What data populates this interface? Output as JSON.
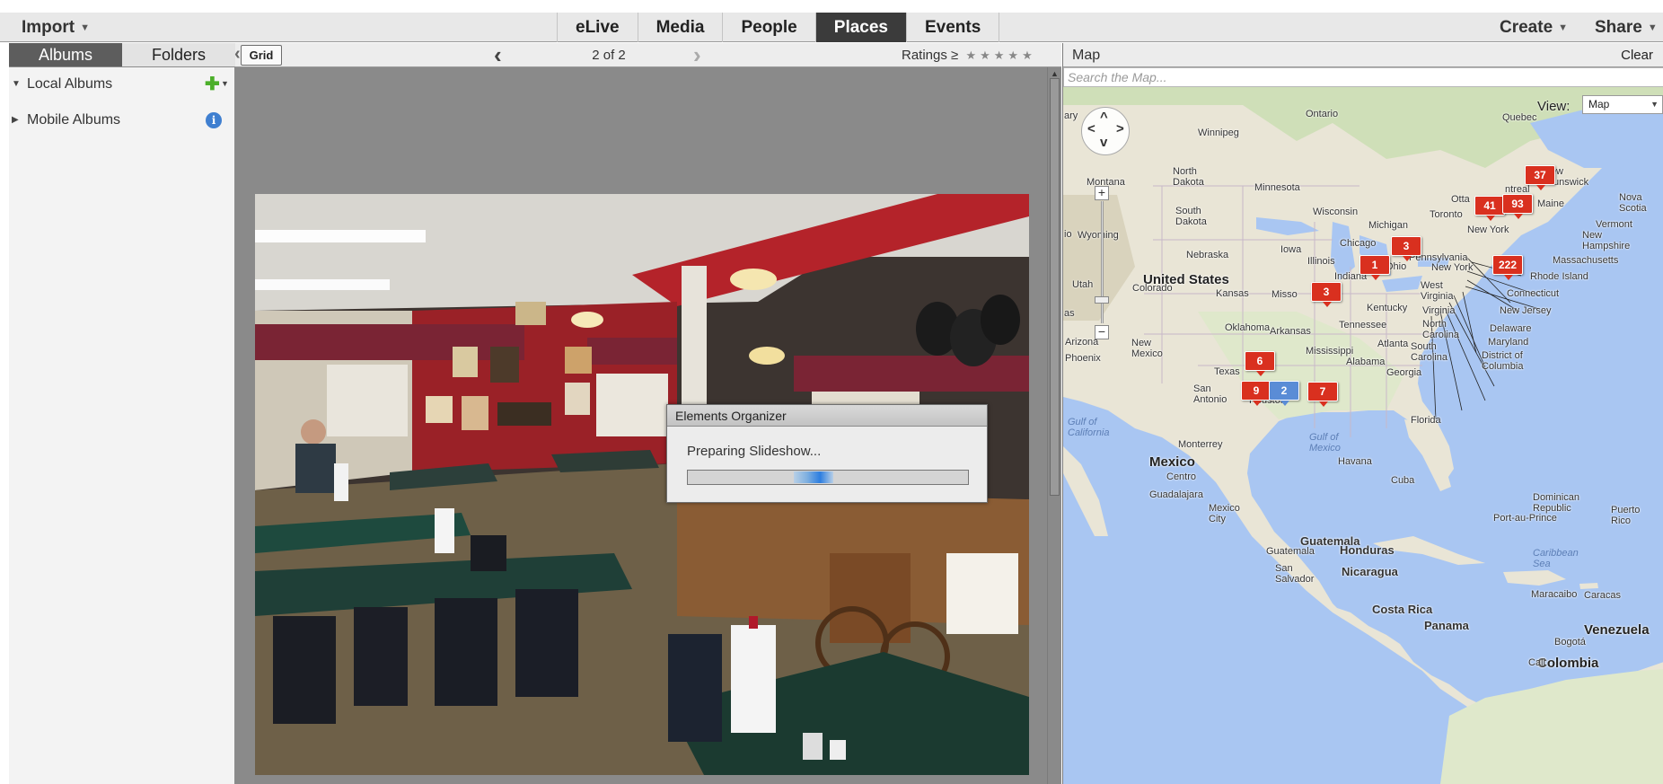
{
  "topbar": {
    "import_label": "Import",
    "create_label": "Create",
    "share_label": "Share",
    "tabs": [
      {
        "label": "eLive",
        "active": false
      },
      {
        "label": "Media",
        "active": false
      },
      {
        "label": "People",
        "active": false
      },
      {
        "label": "Places",
        "active": true
      },
      {
        "label": "Events",
        "active": false
      }
    ]
  },
  "left_panel": {
    "tabs": [
      {
        "label": "Albums",
        "active": true
      },
      {
        "label": "Folders",
        "active": false
      }
    ],
    "tree": [
      {
        "label": "Local Albums",
        "icon": "add-icon"
      },
      {
        "label": "Mobile Albums",
        "icon": "info-icon"
      }
    ]
  },
  "viewer": {
    "grid_label": "Grid",
    "page_count": "2 of 2",
    "ratings_label": "Ratings",
    "ratings_op": "≥",
    "stars": 5
  },
  "dialog": {
    "title": "Elements Organizer",
    "message": "Preparing Slideshow...",
    "progress": "indeterminate"
  },
  "map_panel": {
    "title": "Map",
    "clear_label": "Clear",
    "search_placeholder": "Search the Map...",
    "view_label": "View:",
    "view_value": "Map",
    "markers": [
      "37",
      "41",
      "93",
      "3",
      "1",
      "222",
      "3",
      "6",
      "9",
      "2",
      "7"
    ],
    "labels": {
      "us": "United States",
      "mexico": "Mexico",
      "venezuela": "Venezuela",
      "colombia": "Colombia",
      "ontario": "Ontario",
      "quebec": "Quebec",
      "winnipeg": "Winnipeg",
      "north_dakota": "North\nDakota",
      "south_dakota": "South\nDakota",
      "minnesota": "Minnesota",
      "wisconsin": "Wisconsin",
      "michigan": "Michigan",
      "montana": "Montana",
      "wyoming": "Wyoming",
      "nebraska": "Nebraska",
      "iowa": "Iowa",
      "illinois": "Illinois",
      "chicago": "Chicago",
      "indiana": "Indiana",
      "ohio": "Ohio",
      "pennsylvania": "Pennsylvania",
      "new_york_state": "New York",
      "new_york_city": "New York",
      "toronto": "Toronto",
      "ottawa": "Otta",
      "montreal": "ntreal",
      "maine": "Maine",
      "new_brunswick": "New\nBrunswick",
      "nova_scotia": "Nova\nScotia",
      "vermont": "Vermont",
      "new_hampshire": "New\nHampshire",
      "massachusetts": "Massachusetts",
      "rhode_island": "Rhode Island",
      "connecticut": "Connecticut",
      "new_jersey": "New Jersey",
      "delaware": "Delaware",
      "maryland": "Maryland",
      "dc": "District of\nColumbia",
      "colorado": "Colorado",
      "utah": "Utah",
      "kansas": "Kansas",
      "missouri": "Misso",
      "kentucky": "Kentucky",
      "west_virginia": "West\nVirginia",
      "virginia": "Virginia",
      "oklahoma": "Oklahoma",
      "arkansas": "Arkansas",
      "tennessee": "Tennessee",
      "north_carolina": "North\nCarolina",
      "south_carolina": "South\nCarolina",
      "atlanta": "Atlanta",
      "mississippi": "Mississippi",
      "alabama": "Alabama",
      "georgia": "Georgia",
      "texas": "Texas",
      "san_antonio": "San\nAntonio",
      "houston": "Houston",
      "florida": "Florida",
      "arizona": "Arizona",
      "new_mexico": "New\nMexico",
      "phoenix": "Phoenix",
      "monterrey": "Monterrey",
      "gulf_mexico": "Gulf of\nMexico",
      "gulf_california": "Gulf of\nCalifornia",
      "havana": "Havana",
      "cuba": "Cuba",
      "dominican": "Dominican\nRepublic",
      "puerto_rico": "Puerto\nRico",
      "port_au_prince": "Port-au-Prince",
      "centro": "Centro",
      "guadalajara": "Guadalajara",
      "mexico_city": "Mexico\nCity",
      "guatemala": "Guatemala",
      "guatemala_city": "Guatemala",
      "honduras": "Honduras",
      "san_salvador": "San\nSalvador",
      "nicaragua": "Nicaragua",
      "costa_rica": "Costa Rica",
      "panama": "Panama",
      "caribbean": "Caribbean\nSea",
      "maracaibo": "Maracaibo",
      "caracas": "Caracas",
      "bogota": "Bogotá",
      "cali": "Cali",
      "ary": "ary",
      "io": "io",
      "as": "as"
    }
  },
  "colors": {
    "active_tab": "#3b3b3b",
    "marker_red": "#d9301f",
    "marker_blue": "#5a8cd6",
    "water": "#a9c6f2",
    "land": "#e9e5d6"
  }
}
